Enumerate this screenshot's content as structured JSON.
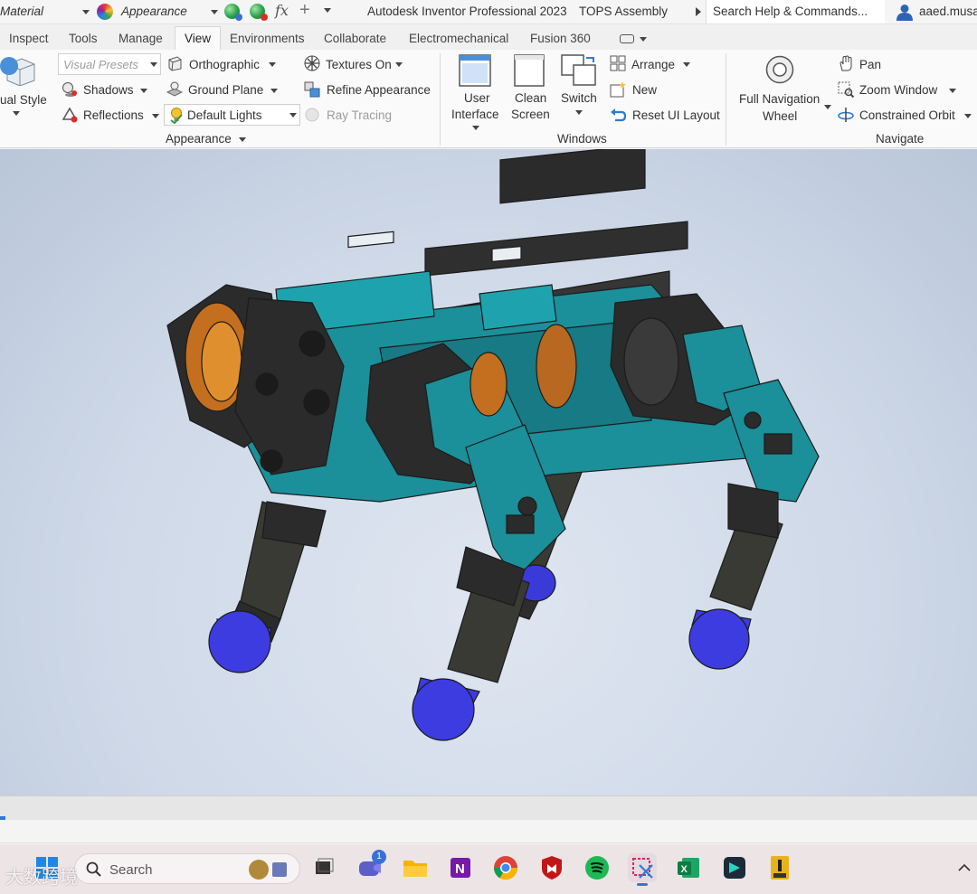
{
  "titlebar": {
    "material_combo": "Material",
    "appearance_combo": "Appearance",
    "fx_glyph": "fx",
    "plus_glyph": "+",
    "app_title": "Autodesk Inventor Professional 2023",
    "doc_title": "TOPS Assembly",
    "search_placeholder": "Search Help & Commands...",
    "user": "aaed.musa"
  },
  "tabs": [
    {
      "label": "Inspect"
    },
    {
      "label": "Tools"
    },
    {
      "label": "Manage"
    },
    {
      "label": "View",
      "active": true
    },
    {
      "label": "Environments"
    },
    {
      "label": "Collaborate"
    },
    {
      "label": "Electromechanical"
    },
    {
      "label": "Fusion 360"
    }
  ],
  "ribbon": {
    "visual_style": "ual Style",
    "visual_presets": "Visual Presets",
    "shadows": "Shadows",
    "reflections": "Reflections",
    "orthographic": "Orthographic",
    "ground_plane": "Ground Plane",
    "default_lights": "Default Lights",
    "textures_on": "Textures On",
    "refine_appearance": "Refine Appearance",
    "ray_tracing": "Ray Tracing",
    "appearance_panel": "Appearance",
    "user_interface_1": "User",
    "user_interface_2": "Interface",
    "clean_screen_1": "Clean",
    "clean_screen_2": "Screen",
    "switch": "Switch",
    "arrange": "Arrange",
    "new_window": "New",
    "reset_ui": "Reset UI Layout",
    "windows_panel": "Windows",
    "full_nav_1": "Full Navigation",
    "full_nav_2": "Wheel",
    "pan": "Pan",
    "zoom_window": "Zoom Window",
    "constrained_orbit": "Constrained Orbit",
    "navigate_panel": "Navigate"
  },
  "taskbar": {
    "search_label": "Search",
    "teams_badge": "1",
    "watermark": "大数跨境"
  },
  "colors": {
    "teal": "#1b8f9a",
    "dark_part": "#2f2f2f",
    "foot_blue": "#3c3ce0",
    "accent": "#2d7ad6"
  }
}
